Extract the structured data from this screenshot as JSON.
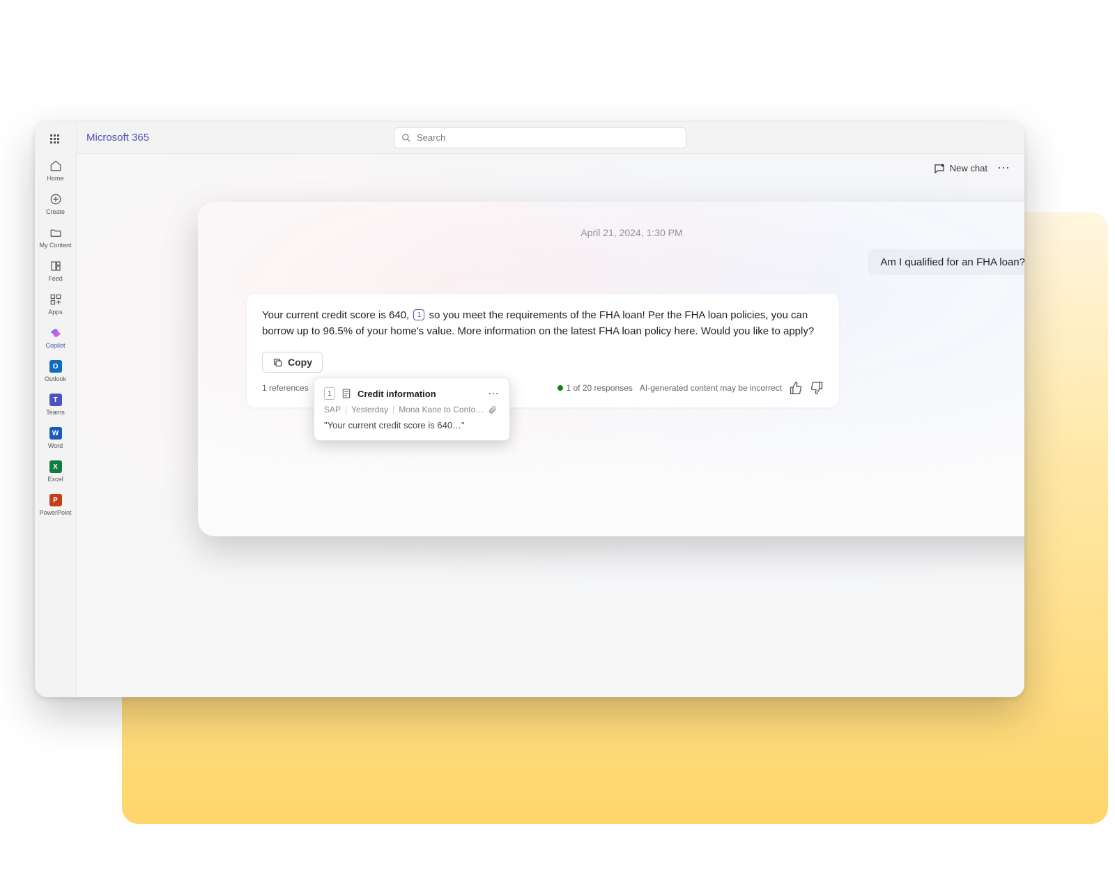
{
  "brand": "Microsoft 365",
  "search": {
    "placeholder": "Search"
  },
  "rail": [
    {
      "label": "Home"
    },
    {
      "label": "Create"
    },
    {
      "label": "My Content"
    },
    {
      "label": "Feed"
    },
    {
      "label": "Apps"
    },
    {
      "label": "Copilot"
    },
    {
      "label": "Outlook"
    },
    {
      "label": "Teams"
    },
    {
      "label": "Word"
    },
    {
      "label": "Excel"
    },
    {
      "label": "PowerPoint"
    }
  ],
  "actions": {
    "new_chat": "New chat"
  },
  "chat": {
    "timestamp": "April 21, 2024, 1:30 PM",
    "user_message": "Am I qualified for an FHA loan?",
    "ai_message_pre": "Your current credit score is 640,",
    "ai_citation": "1",
    "ai_message_post": " so you meet the requirements of the FHA loan! Per the FHA loan policies, you can borrow up to 96.5% of your home's value. More information on the latest FHA loan policy here. Would you like to apply?",
    "copy_label": "Copy",
    "references_label": "1 references",
    "response_count": "1 of 20 responses",
    "disclaimer": "AI-generated content may be incorrect"
  },
  "reference": {
    "num": "1",
    "title": "Credit information",
    "source": "SAP",
    "when": "Yesterday",
    "from_to": "Mona Kane to Conto…",
    "quote": "\"Your current credit score is 640…\""
  }
}
